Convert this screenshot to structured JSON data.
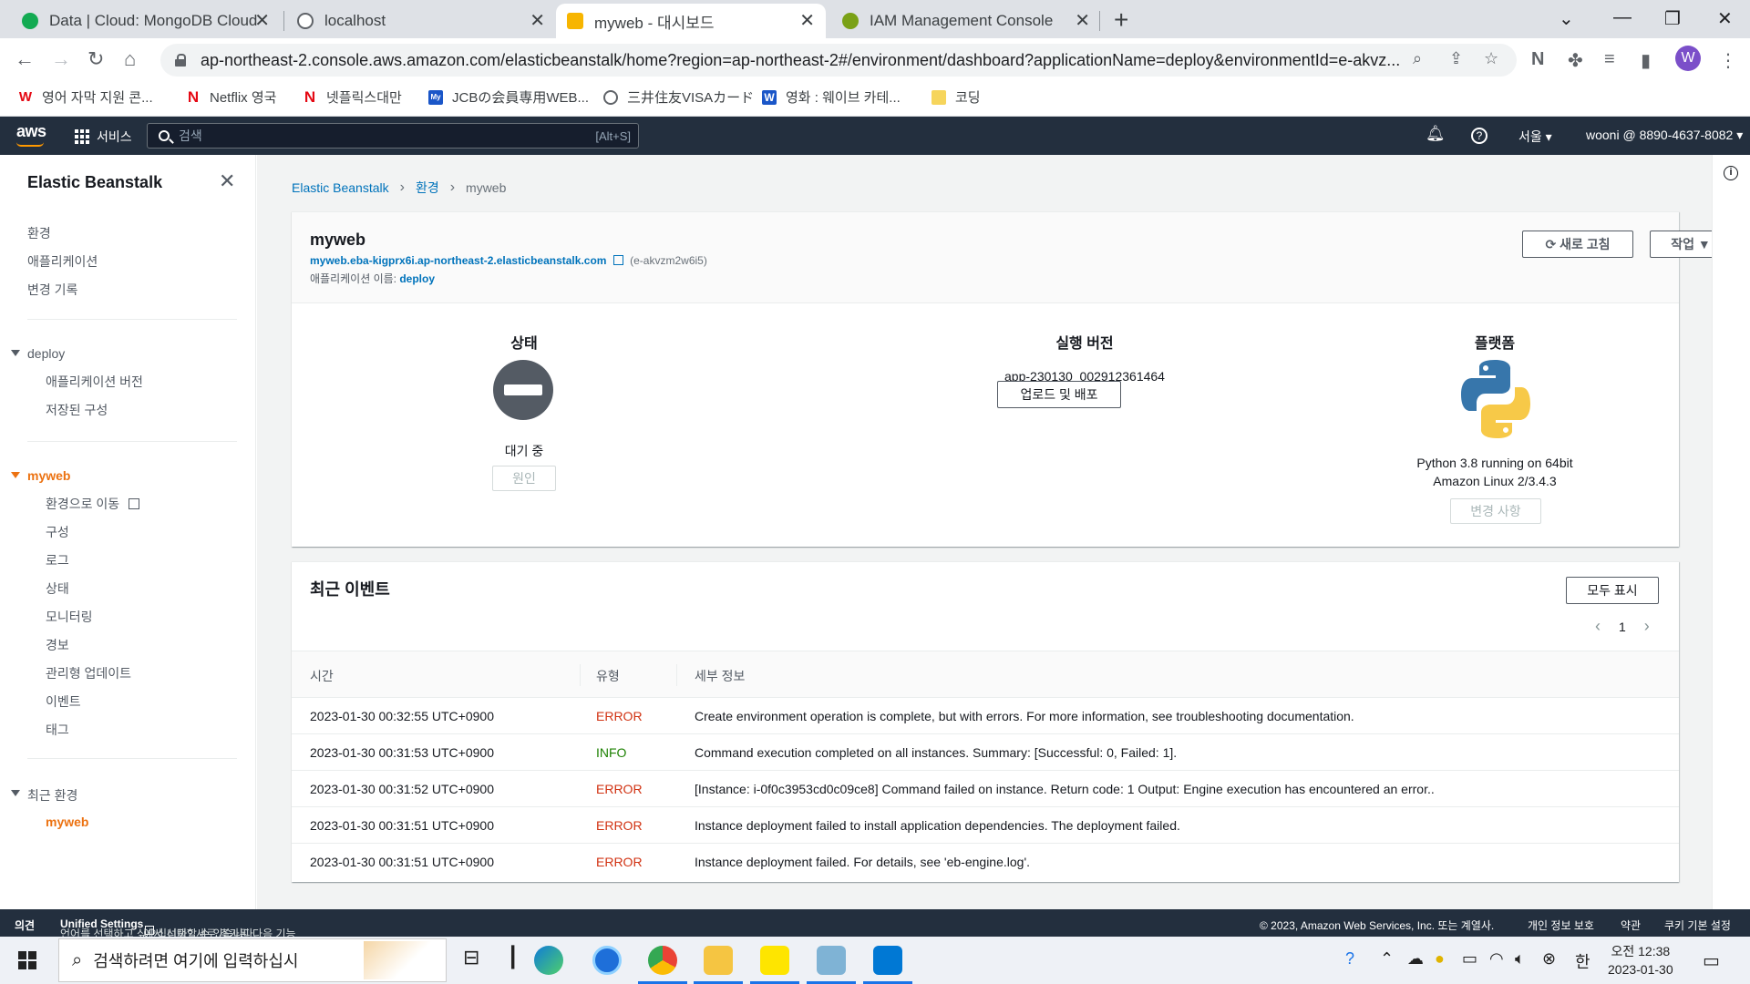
{
  "browser": {
    "tabs": [
      {
        "title": "Data | Cloud: MongoDB Cloud",
        "favicon_color": "#13aa52"
      },
      {
        "title": "localhost",
        "favicon_color": "#5f6368"
      },
      {
        "title": "myweb - 대시보드",
        "favicon_color": "#f7b500"
      },
      {
        "title": "IAM Management Console",
        "favicon_color": "#7aa116"
      }
    ],
    "url": "ap-northeast-2.console.aws.amazon.com/elasticbeanstalk/home?region=ap-northeast-2#/environment/dashboard?applicationName=deploy&environmentId=e-akvz...",
    "profile_initial": "W",
    "bookmarks": [
      {
        "label": "영어 자막 지원 콘...",
        "icon": "W",
        "color": "#e50914"
      },
      {
        "label": "Netflix 영국",
        "icon": "N",
        "color": "#e50914"
      },
      {
        "label": "넷플릭스대만",
        "icon": "N",
        "color": "#e50914"
      },
      {
        "label": "JCBの会員専用WEB...",
        "icon": "My",
        "color": "#1a56c8"
      },
      {
        "label": "三井住友VISAカード",
        "icon": "◍",
        "color": "#5f6368"
      },
      {
        "label": "영화 : 웨이브 카테...",
        "icon": "W",
        "color": "#1a56c8"
      },
      {
        "label": "코딩",
        "icon": "",
        "color": "#f6d55c"
      }
    ]
  },
  "aws_nav": {
    "logo": "aws",
    "services": "서비스",
    "search_placeholder": "검색",
    "search_shortcut": "[Alt+S]",
    "region": "서울 ▾",
    "account": "wooni @ 8890-4637-8082 ▾"
  },
  "sidebar": {
    "title": "Elastic Beanstalk",
    "top_items": [
      "환경",
      "애플리케이션",
      "변경 기록"
    ],
    "app_section": {
      "label": "deploy",
      "items": [
        "애플리케이션 버전",
        "저장된 구성"
      ]
    },
    "env_section": {
      "label": "myweb",
      "items": [
        "환경으로 이동",
        "구성",
        "로그",
        "상태",
        "모니터링",
        "경보",
        "관리형 업데이트",
        "이벤트",
        "태그"
      ]
    },
    "recent_section": {
      "label": "최근 환경",
      "items": [
        "myweb"
      ]
    }
  },
  "breadcrumb": {
    "root": "Elastic Beanstalk",
    "mid": "환경",
    "current": "myweb"
  },
  "env": {
    "name": "myweb",
    "url": "myweb.eba-kigprx6i.ap-northeast-2.elasticbeanstalk.com",
    "env_id": "(e-akvzm2w6i5)",
    "app_label": "애플리케이션 이름: ",
    "app_name": "deploy",
    "refresh_button": "⟳ 새로 고침",
    "actions_button": "작업  ▼",
    "status": {
      "heading": "상태",
      "value": "대기 중",
      "button": "원인"
    },
    "version": {
      "heading": "실행 버전",
      "value": "app-230130_002912361464",
      "button": "업로드 및 배포"
    },
    "platform": {
      "heading": "플랫폼",
      "line1": "Python 3.8 running on 64bit",
      "line2": "Amazon Linux 2/3.4.3",
      "button": "변경 사항"
    }
  },
  "events": {
    "title": "최근 이벤트",
    "show_all": "모두 표시",
    "page": "1",
    "columns": [
      "시간",
      "유형",
      "세부 정보"
    ],
    "rows": [
      {
        "time": "2023-01-30 00:32:55 UTC+0900",
        "type": "ERROR",
        "detail": "Create environment operation is complete, but with errors. For more information, see troubleshooting documentation."
      },
      {
        "time": "2023-01-30 00:31:53 UTC+0900",
        "type": "INFO",
        "detail": "Command execution completed on all instances. Summary: [Successful: 0, Failed: 1]."
      },
      {
        "time": "2023-01-30 00:31:52 UTC+0900",
        "type": "ERROR",
        "detail": "[Instance: i-0f0c3953cd0c09ce8] Command failed on instance. Return code: 1 Output: Engine execution has encountered an error.."
      },
      {
        "time": "2023-01-30 00:31:51 UTC+0900",
        "type": "ERROR",
        "detail": "Instance deployment failed to install application dependencies. The deployment failed."
      },
      {
        "time": "2023-01-30 00:31:51 UTC+0900",
        "type": "ERROR",
        "detail": "Instance deployment failed. For details, see 'eb-engine.log'."
      }
    ]
  },
  "footer": {
    "feedback": "의견",
    "language_pre": "언어를 선택하고 싶으십니까? 새로 추가된 다음 기능",
    "language_link": "Unified Settings",
    "language_post": "에서 선택할 수 있습니다.",
    "copyright": "© 2023, Amazon Web Services, Inc. 또는 계열사.",
    "privacy": "개인 정보 보호",
    "terms": "약관",
    "cookies": "쿠키 기본 설정"
  },
  "taskbar": {
    "search_placeholder": "검색하려면 여기에 입력하십시",
    "ime": "한",
    "time": "오전 12:38",
    "date": "2023-01-30"
  }
}
